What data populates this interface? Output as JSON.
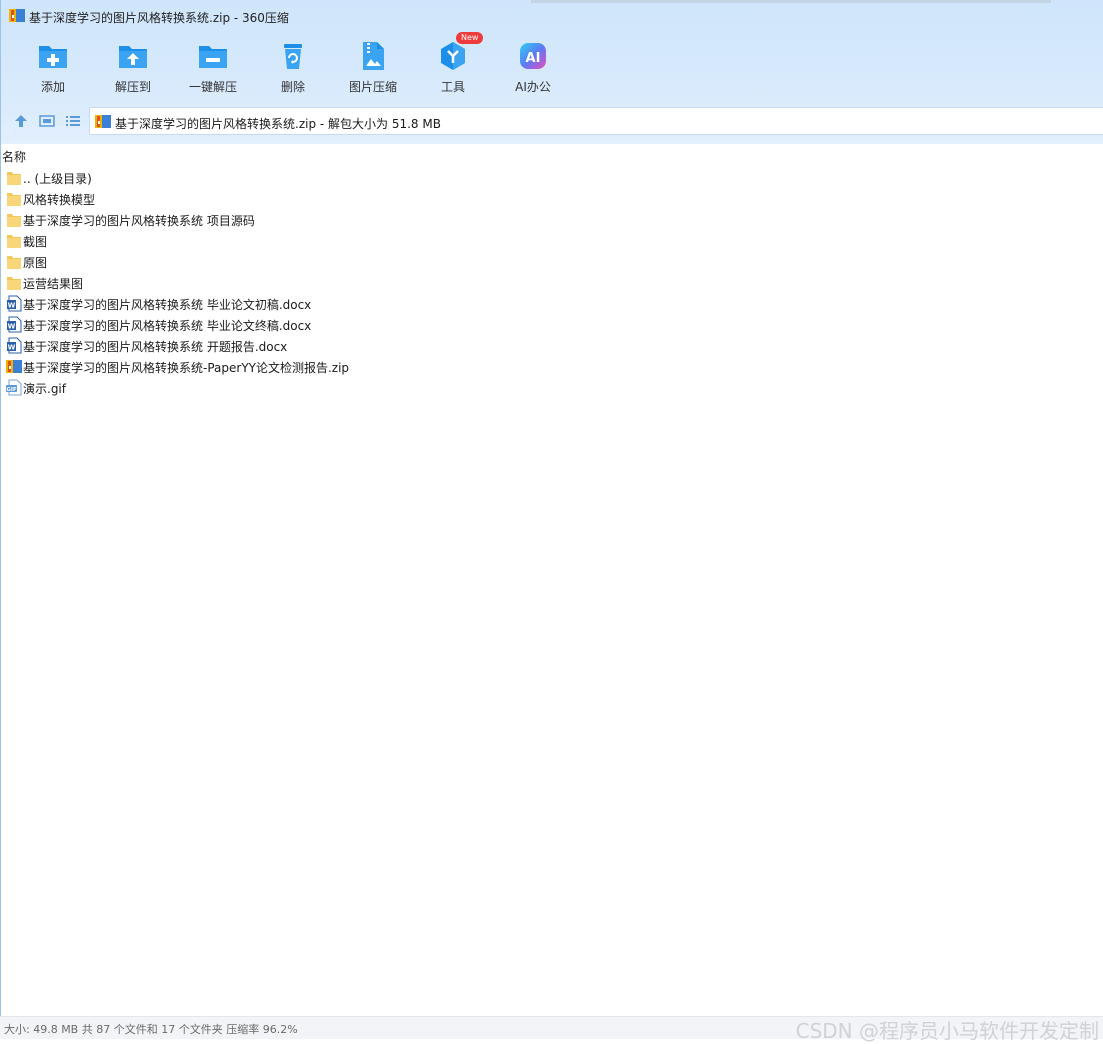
{
  "window": {
    "title": "基于深度学习的图片风格转换系统.zip - 360压缩"
  },
  "toolbar": {
    "items": [
      {
        "label": "添加",
        "icon": "add-icon"
      },
      {
        "label": "解压到",
        "icon": "extract-to-icon"
      },
      {
        "label": "一键解压",
        "icon": "one-click-extract-icon"
      },
      {
        "label": "删除",
        "icon": "delete-icon"
      },
      {
        "label": "图片压缩",
        "icon": "image-compress-icon"
      },
      {
        "label": "工具",
        "icon": "tools-icon",
        "badge": "New"
      },
      {
        "label": "AI办公",
        "icon": "ai-office-icon"
      }
    ],
    "accent": "#1e8fe8"
  },
  "nav": {
    "path_text": "基于深度学习的图片风格转换系统.zip - 解包大小为 51.8 MB"
  },
  "list": {
    "column_name": "名称",
    "items": [
      {
        "name": ".. (上级目录)",
        "type": "folder"
      },
      {
        "name": "风格转换模型",
        "type": "folder"
      },
      {
        "name": "基于深度学习的图片风格转换系统 项目源码",
        "type": "folder"
      },
      {
        "name": "截图",
        "type": "folder"
      },
      {
        "name": "原图",
        "type": "folder"
      },
      {
        "name": "运营结果图",
        "type": "folder"
      },
      {
        "name": "基于深度学习的图片风格转换系统 毕业论文初稿.docx",
        "type": "docx"
      },
      {
        "name": "基于深度学习的图片风格转换系统 毕业论文终稿.docx",
        "type": "docx"
      },
      {
        "name": "基于深度学习的图片风格转换系统 开题报告.docx",
        "type": "docx"
      },
      {
        "name": "基于深度学习的图片风格转换系统-PaperYY论文检测报告.zip",
        "type": "zip"
      },
      {
        "name": "演示.gif",
        "type": "gif"
      }
    ]
  },
  "status": {
    "text": "大小: 49.8 MB 共 87 个文件和 17 个文件夹 压缩率 96.2%",
    "watermark": "CSDN @程序员小马软件开发定制"
  }
}
